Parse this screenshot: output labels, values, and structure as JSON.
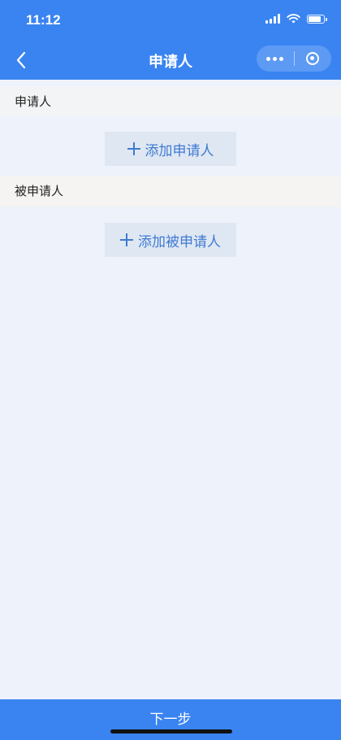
{
  "status_bar": {
    "time": "11:12",
    "icons": [
      "signal-icon",
      "wifi-icon",
      "battery-icon"
    ]
  },
  "nav": {
    "title": "申请人",
    "back_icon": "chevron-left-icon",
    "more_icon": "more-dots-icon",
    "close_icon": "target-circle-icon"
  },
  "sections": [
    {
      "title": "申请人",
      "add_label": "添加申请人"
    },
    {
      "title": "被申请人",
      "add_label": "添加被申请人"
    }
  ],
  "footer": {
    "next_label": "下一步"
  },
  "colors": {
    "primary": "#3a84f2",
    "page_bg": "#eef2fa",
    "button_bg": "#dfe7f3",
    "button_text": "#3f7bd2"
  }
}
